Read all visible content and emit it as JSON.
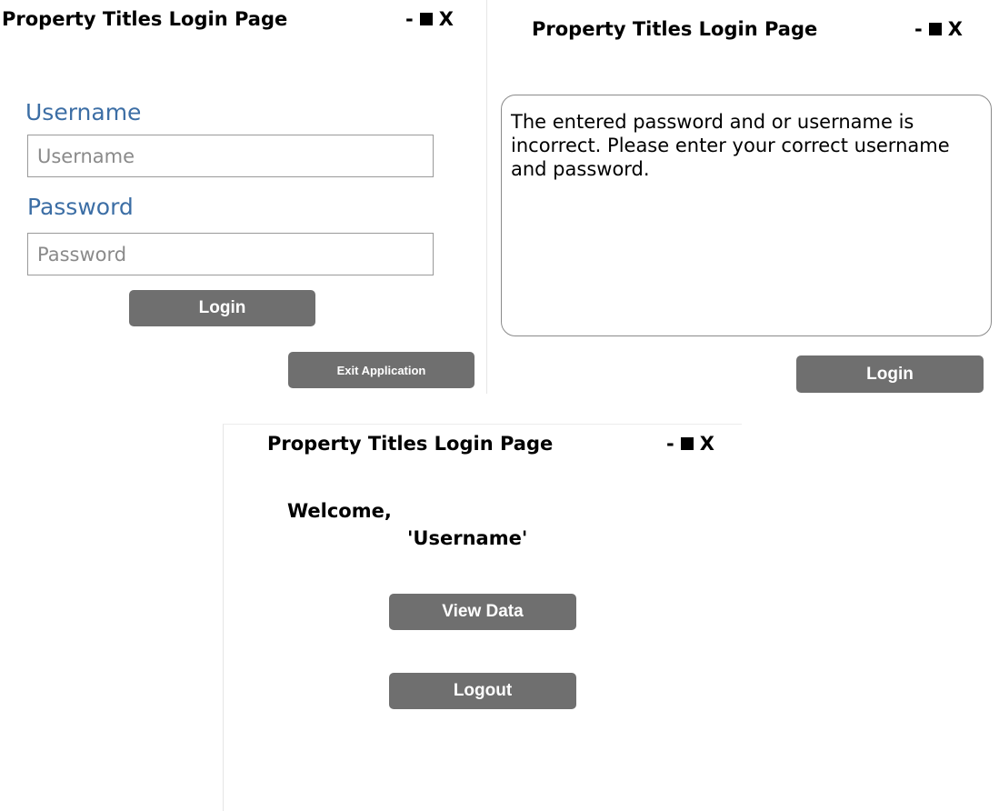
{
  "login_window": {
    "title": "Property Titles Login Page",
    "controls": {
      "minimize": "-",
      "close": "X"
    },
    "username_label": "Username",
    "username_placeholder": "Username",
    "password_label": "Password",
    "password_placeholder": "Password",
    "login_button": "Login",
    "exit_button": "Exit Application"
  },
  "error_window": {
    "title": "Property Titles Login Page",
    "controls": {
      "minimize": "-",
      "close": "X"
    },
    "message": "The entered password and or username is incorrect. Please enter your correct username and password.",
    "login_button": "Login"
  },
  "welcome_window": {
    "title": "Property Titles Login Page",
    "controls": {
      "minimize": "-",
      "close": "X"
    },
    "welcome_text": "Welcome,",
    "username_text": "'Username'",
    "view_data_button": "View Data",
    "logout_button": "Logout"
  },
  "colors": {
    "label_blue": "#3c6ea5",
    "button_gray": "#6f6f6f",
    "input_border": "#9a9a9a"
  }
}
